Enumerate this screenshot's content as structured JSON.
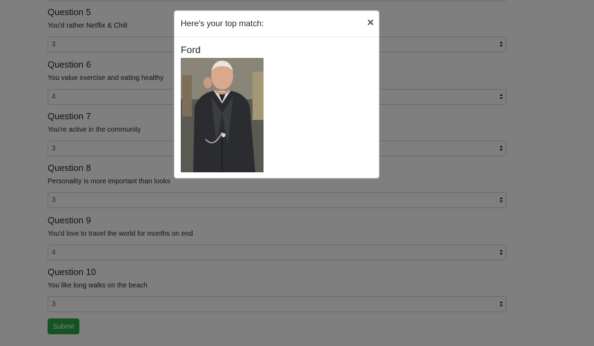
{
  "questions": [
    {
      "title": "Question 5",
      "text": "You'd rather Netflix & Chill",
      "value": "3"
    },
    {
      "title": "Question 6",
      "text": "You value exercise and eating healthy",
      "value": "4"
    },
    {
      "title": "Question 7",
      "text": "You're active in the community",
      "value": "3"
    },
    {
      "title": "Question 8",
      "text": "Personality is more important than looks",
      "value": "3"
    },
    {
      "title": "Question 9",
      "text": "You'd love to travel the world for months on end",
      "value": "4"
    },
    {
      "title": "Question 10",
      "text": "You like long walks on the beach",
      "value": "3"
    }
  ],
  "submit_label": "Submit",
  "modal": {
    "title": "Here's your top match:",
    "close_symbol": "×",
    "match_name": "Ford"
  },
  "colors": {
    "submit": "#28a745",
    "backdrop": "rgba(0,0,0,0.5)"
  },
  "icons": {
    "select_arrow": "updown-arrow-icon",
    "close": "close-icon"
  }
}
